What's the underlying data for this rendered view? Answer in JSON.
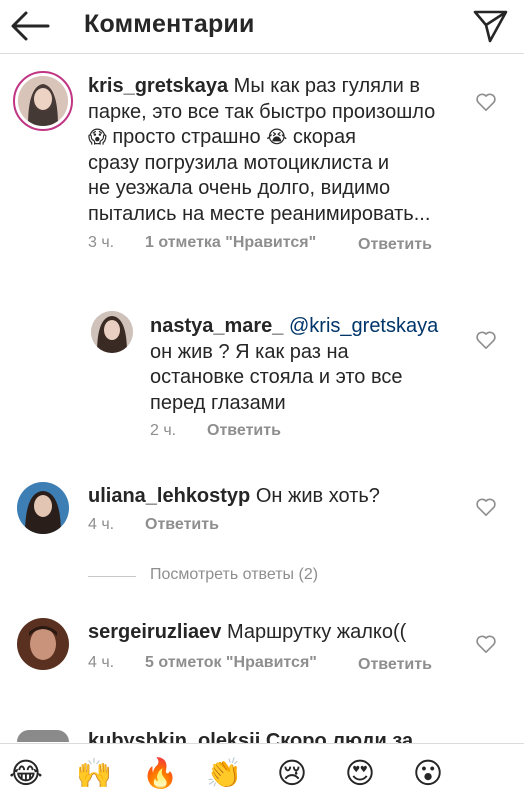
{
  "header": {
    "title": "Комментарии",
    "back_icon": "arrow-left-icon",
    "send_icon": "paper-plane-icon"
  },
  "comments": [
    {
      "username": "kris_gretskaya",
      "lines": [
        "Мы как раз гуляли в",
        "парке, это все так быстро произошло",
        "просто страшно",
        "скорая",
        "сразу погрузила мотоциклиста и",
        "не уезжала очень долго, видимо",
        "пытались на месте реанимировать..."
      ],
      "emoji_a": "😱",
      "emoji_b": "😭",
      "time": "3 ч.",
      "likes": "1 отметка \"Нравится\"",
      "reply_label": "Ответить"
    },
    {
      "username": "nastya_mare_",
      "mention": "@kris_gretskaya",
      "lines": [
        "он жив ? Я как раз на",
        "остановке стояла и это все",
        "перед глазами"
      ],
      "time": "2 ч.",
      "reply_label": "Ответить"
    },
    {
      "username": "uliana_lehkostyp",
      "text": "Он жив хоть?",
      "time": "4 ч.",
      "reply_label": "Ответить"
    },
    {
      "username": "sergeiruzliaev",
      "text": "Маршрутку жалко((",
      "time": "4 ч.",
      "likes": "5 отметок \"Нравится\"",
      "reply_label": "Ответить"
    }
  ],
  "view_replies": "Посмотреть ответы (2)",
  "partial_comment": "kubyshkin_oleksii Скоро люди за",
  "emoji_bar": [
    "😂",
    "🙌",
    "🔥",
    "👏",
    "😢",
    "😍",
    "😮"
  ],
  "colors": {
    "text": "#262626",
    "secondary": "#8e8e8e",
    "mention": "#003569",
    "border": "#dbdbdb",
    "story_ring": "#c13584"
  }
}
